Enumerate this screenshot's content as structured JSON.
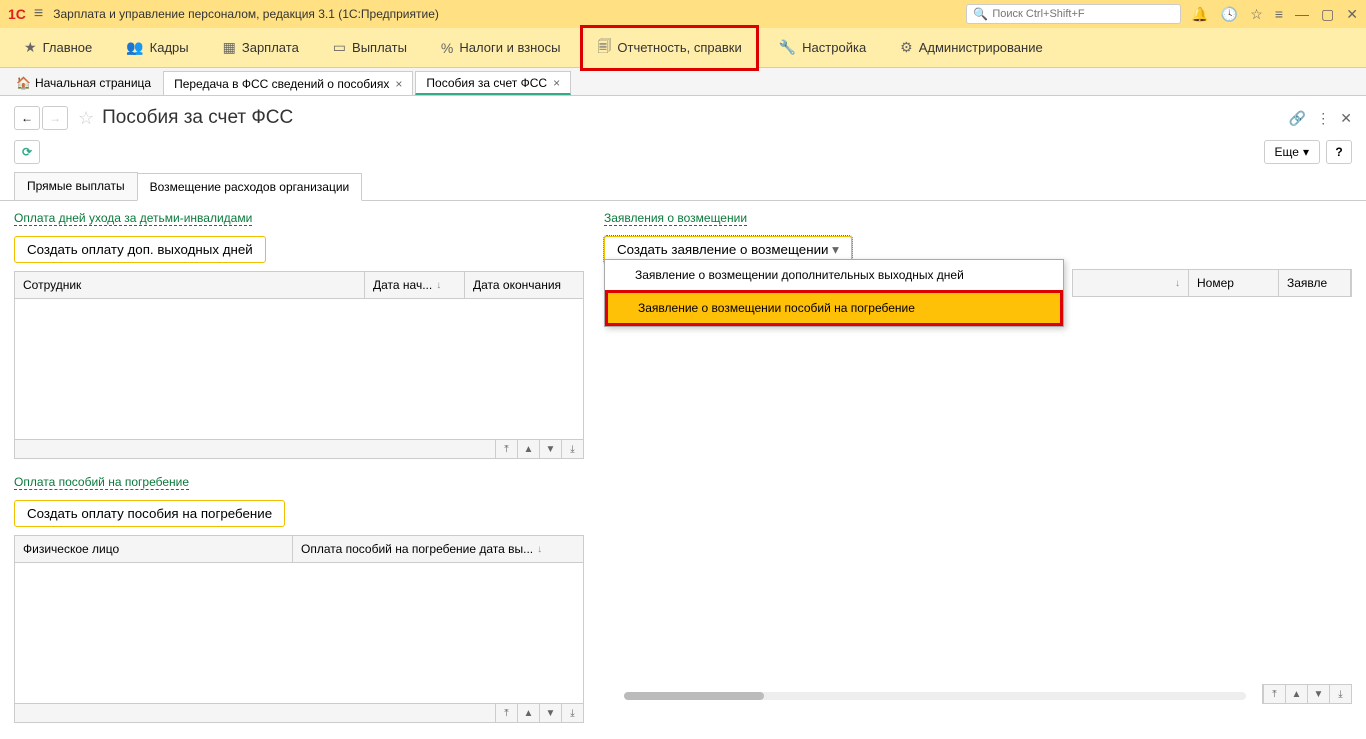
{
  "title": "Зарплата и управление персоналом, редакция 3.1  (1С:Предприятие)",
  "search": {
    "placeholder": "Поиск Ctrl+Shift+F"
  },
  "menu": {
    "main": "Главное",
    "staff": "Кадры",
    "salary": "Зарплата",
    "payments": "Выплаты",
    "taxes": "Налоги и взносы",
    "reports": "Отчетность, справки",
    "settings": "Настройка",
    "admin": "Администрирование"
  },
  "tabs": {
    "home": "Начальная страница",
    "t1": "Передача в ФСС сведений о пособиях",
    "t2": "Пособия за счет ФСС"
  },
  "page": {
    "title": "Пособия за счет ФСС"
  },
  "toolbar": {
    "more": "Еще"
  },
  "subtabs": {
    "direct": "Прямые выплаты",
    "reimb": "Возмещение расходов организации"
  },
  "left": {
    "sec1_title": "Оплата дней ухода за детьми-инвалидами",
    "sec1_btn": "Создать оплату доп. выходных дней",
    "sec2_title": "Оплата пособий на погребение",
    "sec2_btn": "Создать оплату пособия на погребение",
    "cols1": {
      "c1": "Сотрудник",
      "c2": "Дата нач...",
      "c3": "Дата окончания"
    },
    "cols2": {
      "c1": "Физическое лицо",
      "c2": "Оплата пособий на погребение дата вы..."
    }
  },
  "right": {
    "title": "Заявления о возмещении",
    "btn": "Создать заявление о возмещении",
    "dd1": "Заявление о возмещении дополнительных выходных дней",
    "dd2": "Заявление о возмещении пособий на погребение",
    "cols": {
      "c2": "Номер",
      "c3": "Заявле"
    }
  }
}
